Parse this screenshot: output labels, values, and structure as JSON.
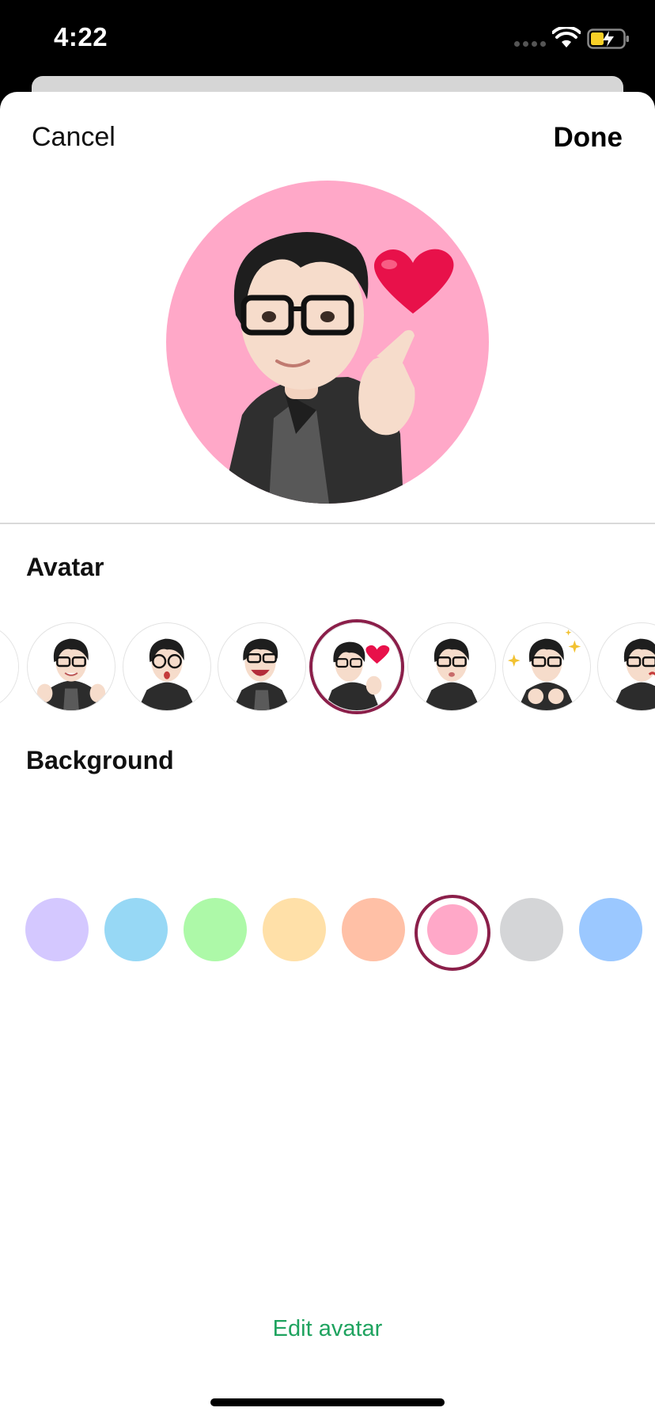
{
  "status_bar": {
    "time": "4:22"
  },
  "header": {
    "cancel_label": "Cancel",
    "done_label": "Done"
  },
  "sections": {
    "avatar_title": "Avatar",
    "background_title": "Background"
  },
  "avatar_options": [
    {
      "pose": "partial",
      "selected": false
    },
    {
      "pose": "thumbs-up",
      "selected": false
    },
    {
      "pose": "surprised",
      "selected": false
    },
    {
      "pose": "laughing",
      "selected": false
    },
    {
      "pose": "finger-heart",
      "selected": true
    },
    {
      "pose": "kiss",
      "selected": false
    },
    {
      "pose": "sparkles",
      "selected": false
    },
    {
      "pose": "wink-partial",
      "selected": false
    }
  ],
  "background_colors": [
    {
      "color": "#d4c8ff",
      "selected": false
    },
    {
      "color": "#97d8f5",
      "selected": false
    },
    {
      "color": "#adf9a8",
      "selected": false
    },
    {
      "color": "#ffe0a8",
      "selected": false
    },
    {
      "color": "#ffc0a6",
      "selected": false
    },
    {
      "color": "#ffa8c8",
      "selected": true
    },
    {
      "color": "#d4d5d7",
      "selected": false
    },
    {
      "color": "#9bc8ff",
      "selected": false
    }
  ],
  "footer": {
    "edit_avatar_label": "Edit avatar"
  },
  "accent_color": "#8b1f4a",
  "link_color": "#1fa35f"
}
